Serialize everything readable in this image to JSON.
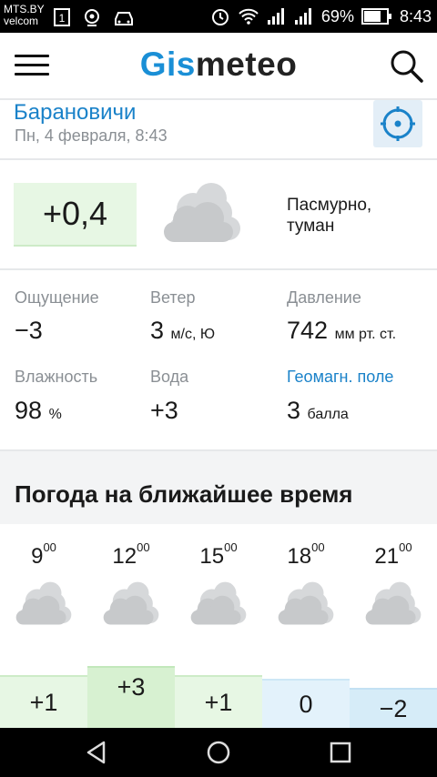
{
  "status_bar": {
    "carrier_line1": "MTS.BY",
    "carrier_line2": "velcom",
    "battery": "69%",
    "time": "8:43"
  },
  "header": {
    "logo_part1": "Gis",
    "logo_part2": "meteo"
  },
  "location": {
    "city": "Барановичи",
    "datetime": "Пн, 4 февраля, 8:43"
  },
  "current": {
    "temperature": "+0,4",
    "condition_line1": "Пасмурно,",
    "condition_line2": "туман",
    "icon": "cloud-icon"
  },
  "details": {
    "feels_label": "Ощущение",
    "feels_value": "−3",
    "wind_label": "Ветер",
    "wind_value": "3",
    "wind_unit": "м/с, Ю",
    "pressure_label": "Давление",
    "pressure_value": "742",
    "pressure_unit": "мм рт. ст.",
    "humidity_label": "Влажность",
    "humidity_value": "98",
    "humidity_unit": "%",
    "water_label": "Вода",
    "water_value": "+3",
    "geomag_label": "Геомагн. поле",
    "geomag_value": "3",
    "geomag_unit": "балла"
  },
  "forecast": {
    "title": "Погода на ближайшее время",
    "hours": [
      {
        "hour": "9",
        "minutes": "00",
        "temp": "+1"
      },
      {
        "hour": "12",
        "minutes": "00",
        "temp": "+3"
      },
      {
        "hour": "15",
        "minutes": "00",
        "temp": "+1"
      },
      {
        "hour": "18",
        "minutes": "00",
        "temp": "0"
      },
      {
        "hour": "21",
        "minutes": "00",
        "temp": "−2"
      }
    ]
  },
  "colors": {
    "accent": "#1a8fd6",
    "warm_bg": "#e7f7e4",
    "cold_bg": "#e3f2fb"
  }
}
